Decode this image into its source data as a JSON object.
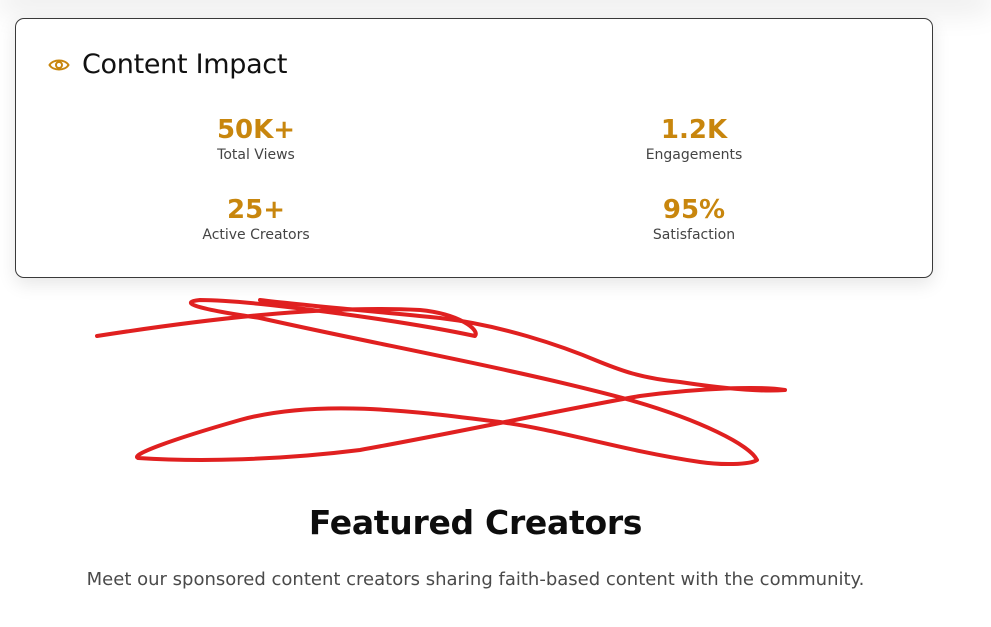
{
  "impact_card": {
    "title": "Content Impact",
    "icon": "eye-icon",
    "accent_color": "#c8860d",
    "stats": [
      {
        "value": "50K+",
        "label": "Total Views"
      },
      {
        "value": "1.2K",
        "label": "Engagements"
      },
      {
        "value": "25+",
        "label": "Active Creators"
      },
      {
        "value": "95%",
        "label": "Satisfaction"
      }
    ]
  },
  "annotation": {
    "color": "#e02020"
  },
  "featured": {
    "title": "Featured Creators",
    "subtitle": "Meet our sponsored content creators sharing faith-based content with the community."
  }
}
